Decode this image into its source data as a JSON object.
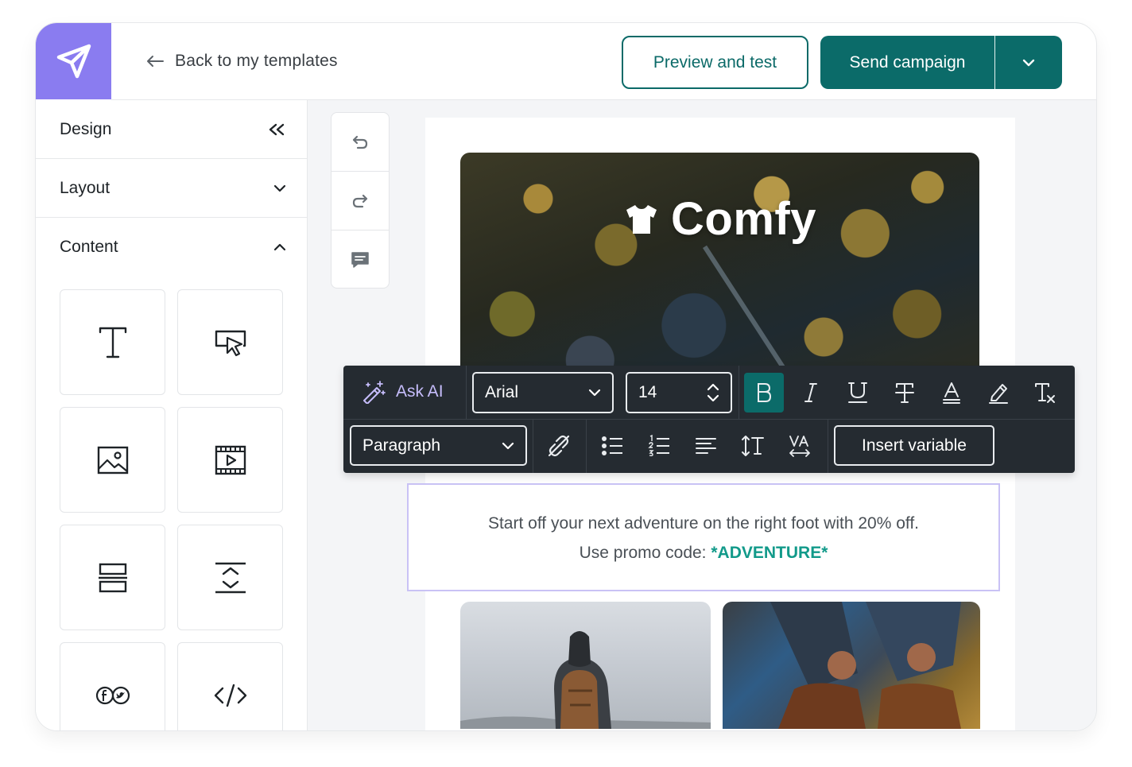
{
  "header": {
    "back_label": "Back to my templates",
    "preview_label": "Preview and test",
    "send_label": "Send campaign"
  },
  "sidebar": {
    "sections": [
      {
        "label": "Design",
        "icon": "double-chevron-left-icon"
      },
      {
        "label": "Layout",
        "icon": "chevron-down-icon"
      },
      {
        "label": "Content",
        "icon": "chevron-up-icon"
      }
    ],
    "content_blocks": [
      "text-block-icon",
      "button-block-icon",
      "image-block-icon",
      "video-block-icon",
      "divider-block-icon",
      "spacer-block-icon",
      "social-block-icon",
      "html-block-icon"
    ]
  },
  "history": [
    "undo-icon",
    "redo-icon",
    "comment-icon"
  ],
  "email": {
    "brand_name": "Comfy",
    "body_line1": "Start off your next adventure on the right foot with 20% off.",
    "body_line2_prefix": "Use promo code: ",
    "promo_code": "*ADVENTURE*"
  },
  "toolbar": {
    "ask_ai_label": "Ask AI",
    "font_family": "Arial",
    "font_size": "14",
    "block_type": "Paragraph",
    "insert_variable_label": "Insert variable",
    "row1_icons": [
      "bold-icon",
      "italic-icon",
      "underline-icon",
      "strikethrough-icon",
      "text-color-icon",
      "highlight-icon",
      "clear-format-icon"
    ],
    "row2_icons": [
      "unlink-icon",
      "bullet-list-icon",
      "numbered-list-icon",
      "align-left-icon",
      "line-height-icon",
      "letter-spacing-icon"
    ],
    "active_icon": "bold-icon"
  },
  "colors": {
    "brand_purple": "#8a7cf0",
    "primary_teal": "#0b6b69",
    "promo_teal": "#129a8a",
    "toolbar_bg": "#252b31"
  }
}
